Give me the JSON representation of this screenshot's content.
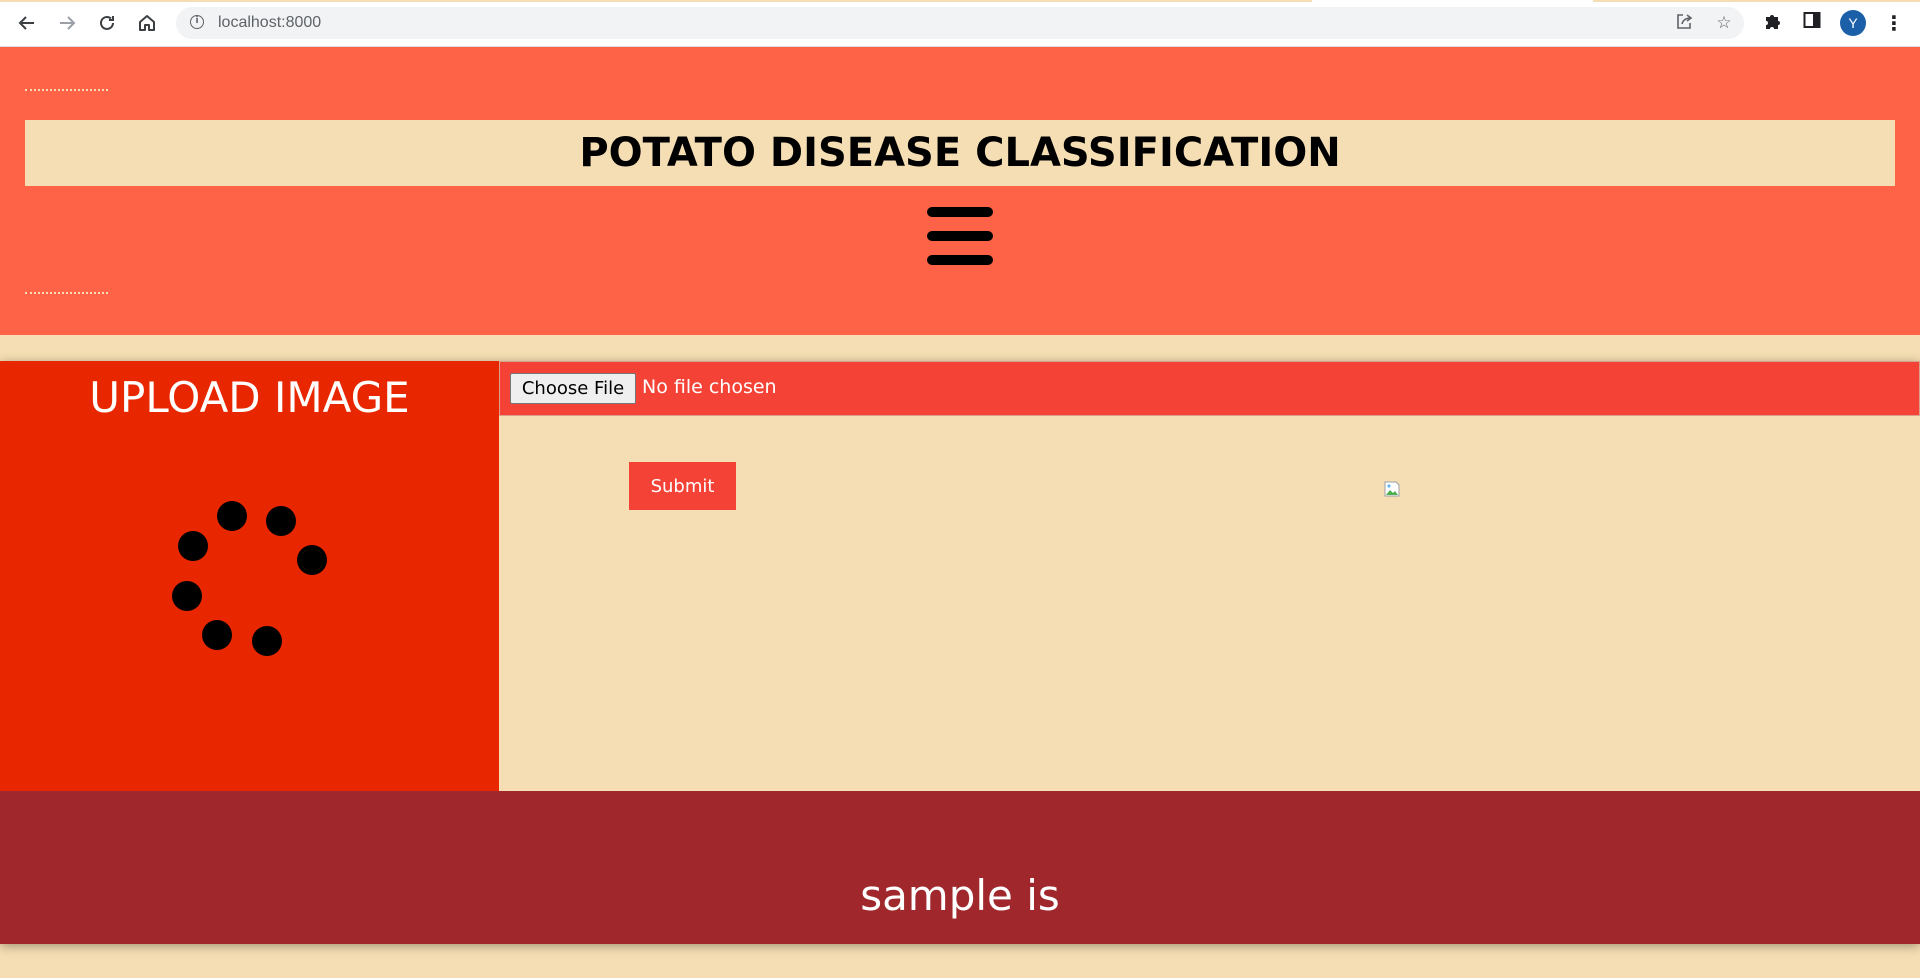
{
  "browser": {
    "url": "localhost:8000",
    "avatar_initial": "Y"
  },
  "header": {
    "title": "POTATO DISEASE CLASSIFICATION"
  },
  "upload_panel": {
    "heading": "UPLOAD IMAGE"
  },
  "form": {
    "choose_file_label": "Choose File",
    "file_status": "No file chosen",
    "submit_label": "Submit"
  },
  "result": {
    "text": "sample is"
  },
  "colors": {
    "header_bg": "#ff6347",
    "title_bar_bg": "#f5deb3",
    "upload_panel_bg": "#e82700",
    "file_bar_bg": "#f44336",
    "submit_bg": "#f44336",
    "result_bg": "#a0282c",
    "page_bg": "#f5deb3"
  },
  "icons": {
    "back": "back-arrow-icon",
    "forward": "forward-arrow-icon",
    "reload": "reload-icon",
    "home": "home-icon",
    "site_info": "info-icon",
    "share": "share-icon",
    "bookmark": "star-icon",
    "extensions": "puzzle-icon",
    "side_panel": "side-panel-icon",
    "menu": "kebab-menu-icon",
    "nav_toggle": "hamburger-icon",
    "loading": "loading-spinner-icon",
    "preview": "broken-image-icon"
  }
}
